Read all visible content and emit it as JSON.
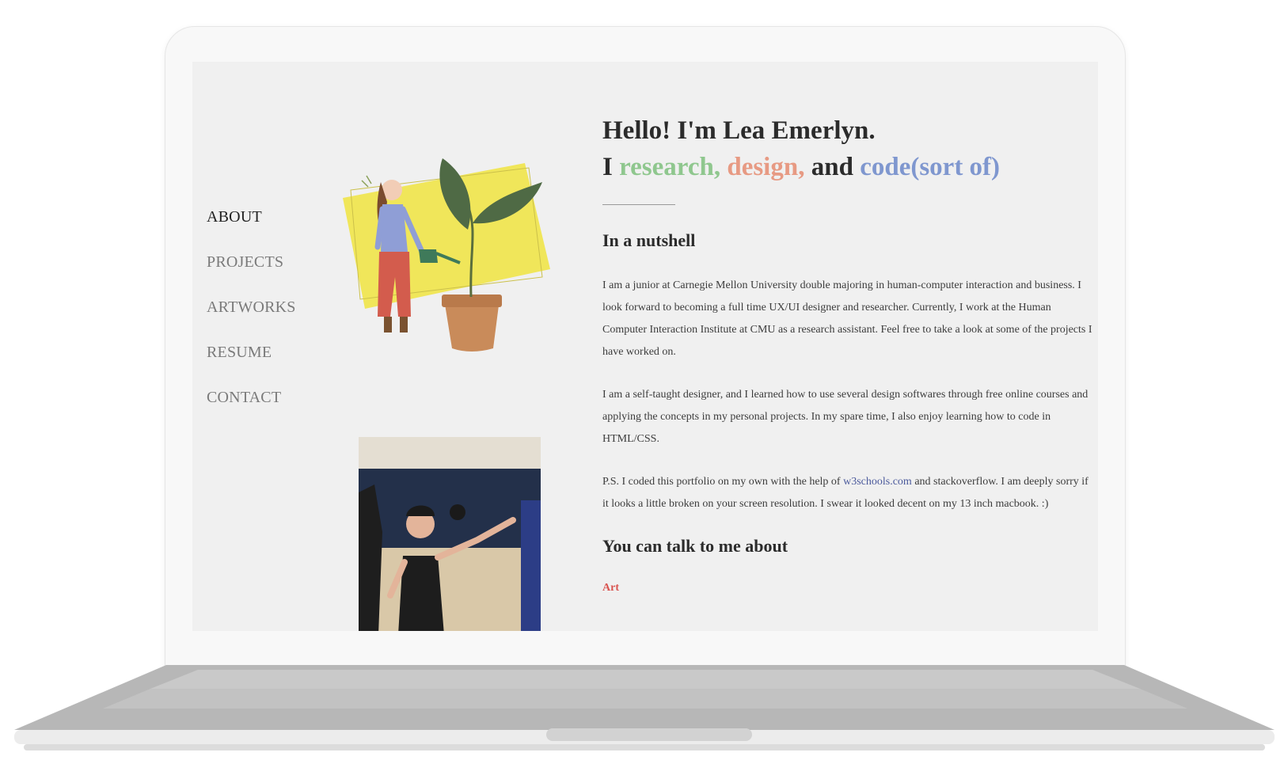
{
  "nav": {
    "items": [
      {
        "label": "ABOUT",
        "active": true
      },
      {
        "label": "PROJECTS",
        "active": false
      },
      {
        "label": "ARTWORKS",
        "active": false
      },
      {
        "label": "RESUME",
        "active": false
      },
      {
        "label": "CONTACT",
        "active": false
      }
    ]
  },
  "hero": {
    "greeting": "Hello! I'm Lea Emerlyn.",
    "prefix": "I",
    "word_research": "research,",
    "word_design": "design,",
    "word_and": "and",
    "word_code": "code(sort of)"
  },
  "nutshell": {
    "heading": "In a nutshell",
    "p1": "I am a junior at Carnegie Mellon University double majoring in human-computer interaction and business. I look forward to becoming a full time UX/UI designer and researcher. Currently, I work at the Human Computer Interaction Institute at CMU as a research assistant. Feel free to take a look at some of the projects I have worked on.",
    "p2": "I am a self-taught designer, and I learned how to use several design softwares through free online courses and applying the concepts in my personal projects. In my spare time, I also enjoy learning how to code in HTML/CSS.",
    "p3_before": "P.S. I coded this portfolio on my own with the help of ",
    "p3_link": "w3schools.com",
    "p3_after": " and stackoverflow. I am deeply sorry if it looks a little broken on your screen resolution. I swear it looked decent on my 13 inch macbook. :)"
  },
  "talk": {
    "heading": "You can talk to me about",
    "topic1": "Art"
  },
  "colors": {
    "research": "#8fc78e",
    "design": "#e79a83",
    "code": "#7f97cf",
    "topic": "#d9534f",
    "screen_bg": "#f0f0f0"
  }
}
